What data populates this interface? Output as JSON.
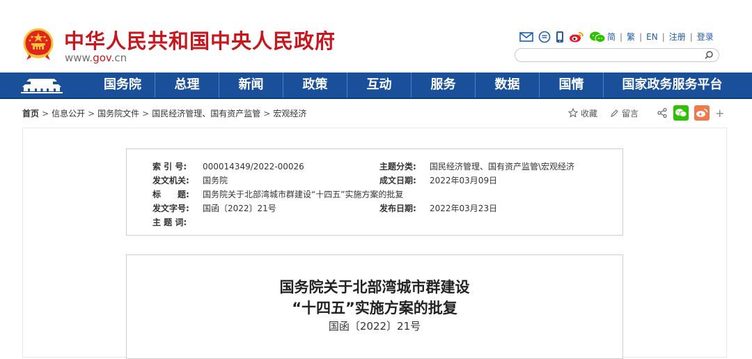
{
  "header": {
    "site_title": "中华人民共和国中央人民政府",
    "domain_prefix": "www.",
    "domain_gov": "gov",
    "domain_suffix": ".cn",
    "icons": [
      "mail-icon",
      "message-icon",
      "mobile-icon",
      "weibo-icon",
      "wechat-icon"
    ],
    "lang_links": [
      "简",
      "繁",
      "EN",
      "注册",
      "登录"
    ],
    "search_placeholder": ""
  },
  "nav": {
    "items": [
      "国务院",
      "总理",
      "新闻",
      "政策",
      "互动",
      "服务",
      "数据",
      "国情",
      "国家政务服务平台"
    ]
  },
  "breadcrumb": {
    "items": [
      "首页",
      "信息公开",
      "国务院文件",
      "国民经济管理、国有资产监管",
      "宏观经济"
    ],
    "separator": ">"
  },
  "tools": {
    "favorite": "收藏",
    "comment": "留言",
    "more": "+"
  },
  "colors": {
    "brand_red": "#c8161d",
    "nav_blue": "#1a4f9a",
    "wechat_green": "#2dc100",
    "weibo_orange": "#f0784b"
  },
  "meta": {
    "index_label": "索 引 号:",
    "index_value": "000014349/2022-00026",
    "topic_label": "主题分类:",
    "topic_value": "国民经济管理、国有资产监管\\宏观经济",
    "issuer_label": "发文机关:",
    "issuer_value": "国务院",
    "written_label": "成文日期:",
    "written_value": "2022年03月09日",
    "title_label": "标　　题:",
    "title_value": "国务院关于北部湾城市群建设“十四五”实施方案的批复",
    "docno_label": "发文字号:",
    "docno_value": "国函〔2022〕21号",
    "published_label": "发布日期:",
    "published_value": "2022年03月23日",
    "keywords_label": "主 题 词:",
    "keywords_value": ""
  },
  "document": {
    "title_line1": "国务院关于北部湾城市群建设",
    "title_line2": "“十四五”实施方案的批复",
    "number": "国函〔2022〕21号"
  }
}
